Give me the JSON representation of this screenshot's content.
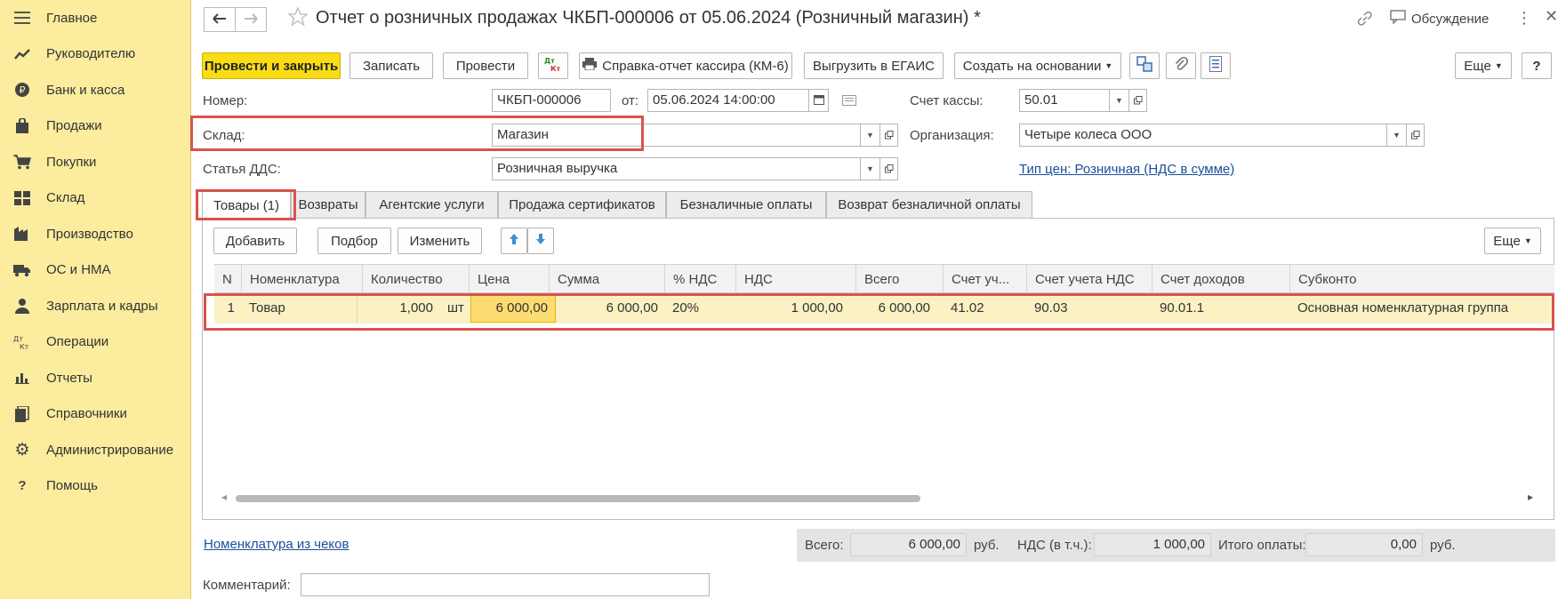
{
  "sidebar": {
    "items": [
      {
        "label": "Главное",
        "icon": "menu-icon"
      },
      {
        "label": "Руководителю",
        "icon": "trend-icon"
      },
      {
        "label": "Банк и касса",
        "icon": "ruble-coin-icon"
      },
      {
        "label": "Продажи",
        "icon": "shopping-bag-icon"
      },
      {
        "label": "Покупки",
        "icon": "cart-icon"
      },
      {
        "label": "Склад",
        "icon": "warehouse-icon"
      },
      {
        "label": "Производство",
        "icon": "factory-icon"
      },
      {
        "label": "ОС и НМА",
        "icon": "truck-icon"
      },
      {
        "label": "Зарплата и кадры",
        "icon": "person-icon"
      },
      {
        "label": "Операции",
        "icon": "dt-kt-icon"
      },
      {
        "label": "Отчеты",
        "icon": "bar-chart-icon"
      },
      {
        "label": "Справочники",
        "icon": "book-icon"
      },
      {
        "label": "Администрирование",
        "icon": "gear-icon"
      },
      {
        "label": "Помощь",
        "icon": "help-icon"
      }
    ]
  },
  "header": {
    "title": "Отчет о розничных продажах ЧКБП-000006 от 05.06.2024 (Розничный магазин) *",
    "discussion_label": "Обсуждение"
  },
  "toolbar": {
    "post_close": "Провести и закрыть",
    "save": "Записать",
    "post": "Провести",
    "dtkt": "Дт Кт",
    "cashier_report": "Справка-отчет кассира (КМ-6)",
    "egais": "Выгрузить в ЕГАИС",
    "create_based": "Создать на основании",
    "more": "Еще",
    "help": "?"
  },
  "form": {
    "number_label": "Номер:",
    "number_value": "ЧКБП-000006",
    "from_label": "от:",
    "date_value": "05.06.2024 14:00:00",
    "cash_account_label": "Счет кассы:",
    "cash_account_value": "50.01",
    "warehouse_label": "Склад:",
    "warehouse_value": "Магазин",
    "organization_label": "Организация:",
    "organization_value": "Четыре колеса ООО",
    "dds_label": "Статья ДДС:",
    "dds_value": "Розничная выручка",
    "price_type_link": "Тип цен: Розничная (НДС в сумме)"
  },
  "tabs": [
    {
      "label": "Товары (1)"
    },
    {
      "label": "Возвраты"
    },
    {
      "label": "Агентские услуги"
    },
    {
      "label": "Продажа сертификатов"
    },
    {
      "label": "Безналичные оплаты"
    },
    {
      "label": "Возврат безналичной оплаты"
    }
  ],
  "table_toolbar": {
    "add": "Добавить",
    "select": "Подбор",
    "change": "Изменить",
    "more": "Еще"
  },
  "table": {
    "columns": [
      "N",
      "Номенклатура",
      "Количество",
      "Цена",
      "Сумма",
      "% НДС",
      "НДС",
      "Всего",
      "Счет уч...",
      "Счет учета НДС",
      "Счет доходов",
      "Субконто"
    ],
    "rows": [
      {
        "n": "1",
        "item": "Товар",
        "qty": "1,000",
        "unit": "шт",
        "price": "6 000,00",
        "sum": "6 000,00",
        "vat_rate": "20%",
        "vat": "1 000,00",
        "total": "6 000,00",
        "account": "41.02",
        "vat_account": "90.03",
        "income_account": "90.01.1",
        "subconto": "Основная номенклатурная группа"
      }
    ]
  },
  "footer": {
    "receipts_link": "Номенклатура из чеков",
    "total_label": "Всего:",
    "total_value": "6 000,00",
    "currency": "руб.",
    "vat_label": "НДС (в т.ч.):",
    "vat_value": "1 000,00",
    "payment_label": "Итого оплаты:",
    "payment_value": "0,00",
    "comment_label": "Комментарий:",
    "comment_value": ""
  },
  "colors": {
    "sidebar_bg": "#fbec9e",
    "primary_button": "#f9dc16",
    "highlight_row": "#fbf1c3",
    "selected_cell": "#fddc71",
    "annotation_red": "#d9534f",
    "link": "#1b4f99"
  }
}
